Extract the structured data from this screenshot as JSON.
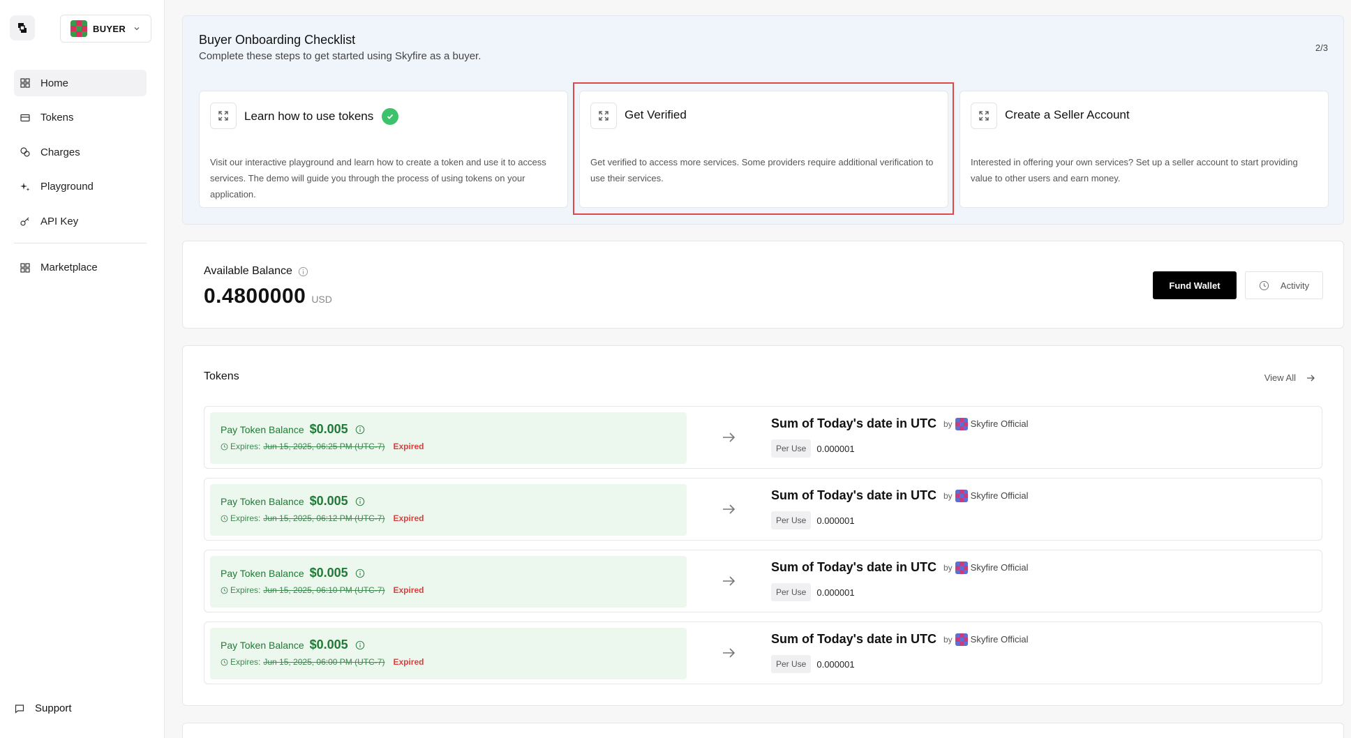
{
  "sidebar": {
    "role_label": "BUYER",
    "items": [
      {
        "label": "Home",
        "icon": "grid-icon"
      },
      {
        "label": "Tokens",
        "icon": "ticket-icon"
      },
      {
        "label": "Charges",
        "icon": "coins-icon"
      },
      {
        "label": "Playground",
        "icon": "sparkles-icon"
      },
      {
        "label": "API Key",
        "icon": "key-icon"
      },
      {
        "label": "Marketplace",
        "icon": "grid-icon"
      }
    ],
    "support_label": "Support"
  },
  "checklist": {
    "title": "Buyer Onboarding Checklist",
    "subtitle": "Complete these steps to get started using Skyfire as a buyer.",
    "progress": "2/3",
    "cards": [
      {
        "title": "Learn how to use tokens",
        "completed": true,
        "description": "Visit our interactive playground and learn how to create a token and use it to access services. The demo will guide you through the process of using tokens on your application."
      },
      {
        "title": "Get Verified",
        "completed": false,
        "description": "Get verified to access more services. Some providers require additional verification to use their services."
      },
      {
        "title": "Create a Seller Account",
        "completed": false,
        "description": "Interested in offering your own services? Set up a seller account to start providing value to other users and earn money."
      }
    ]
  },
  "balance": {
    "label": "Available Balance",
    "amount": "0.4800000",
    "currency": "USD",
    "fund_button": "Fund Wallet",
    "activity_button": "Activity"
  },
  "tokens": {
    "title": "Tokens",
    "view_all": "View All",
    "rows": [
      {
        "balance_label": "Pay Token Balance",
        "balance": "$0.005",
        "expires_label": "Expires:",
        "expires": "Jun 15, 2025, 06:25 PM (UTC-7)",
        "status": "Expired",
        "service": "Sum of Today's date in UTC",
        "by": "by",
        "provider": "Skyfire Official",
        "price_label": "Per Use",
        "price": "0.000001"
      },
      {
        "balance_label": "Pay Token Balance",
        "balance": "$0.005",
        "expires_label": "Expires:",
        "expires": "Jun 15, 2025, 06:12 PM (UTC-7)",
        "status": "Expired",
        "service": "Sum of Today's date in UTC",
        "by": "by",
        "provider": "Skyfire Official",
        "price_label": "Per Use",
        "price": "0.000001"
      },
      {
        "balance_label": "Pay Token Balance",
        "balance": "$0.005",
        "expires_label": "Expires:",
        "expires": "Jun 15, 2025, 06:10 PM (UTC-7)",
        "status": "Expired",
        "service": "Sum of Today's date in UTC",
        "by": "by",
        "provider": "Skyfire Official",
        "price_label": "Per Use",
        "price": "0.000001"
      },
      {
        "balance_label": "Pay Token Balance",
        "balance": "$0.005",
        "expires_label": "Expires:",
        "expires": "Jun 15, 2025, 06:00 PM (UTC-7)",
        "status": "Expired",
        "service": "Sum of Today's date in UTC",
        "by": "by",
        "provider": "Skyfire Official",
        "price_label": "Per Use",
        "price": "0.000001"
      }
    ]
  },
  "colors": {
    "accent_green": "#1f7a35",
    "expired_red": "#e03c3c",
    "highlight_red": "#e04848",
    "checklist_bg": "#f0f4fb"
  }
}
